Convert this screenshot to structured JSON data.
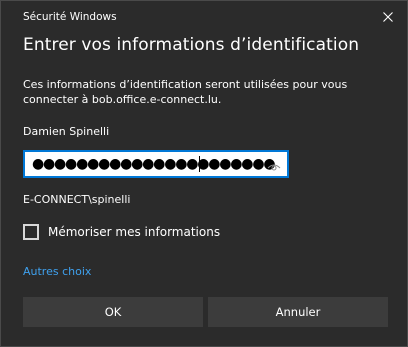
{
  "window": {
    "title": "Sécurité Windows",
    "close_icon": "close-icon"
  },
  "dialog": {
    "heading": "Entrer vos informations d’identification",
    "description": "Ces informations d’identification seront utilisées pour vous connecter à bob.office.e-connect.lu.",
    "username": "Damien Spinelli",
    "password_masked": "●●●●●●●●●●●●●●●●●●●●●●",
    "reveal_icon": "eye-icon",
    "domain_user": "E-CONNECT\\spinelli",
    "remember_label": "Mémoriser mes informations",
    "remember_checked": false,
    "more_choices": "Autres choix",
    "ok_label": "OK",
    "cancel_label": "Annuler"
  },
  "colors": {
    "background": "#2b2b2b",
    "accent": "#0078d7",
    "link": "#3fa1ee",
    "button": "#3c3c3c"
  }
}
